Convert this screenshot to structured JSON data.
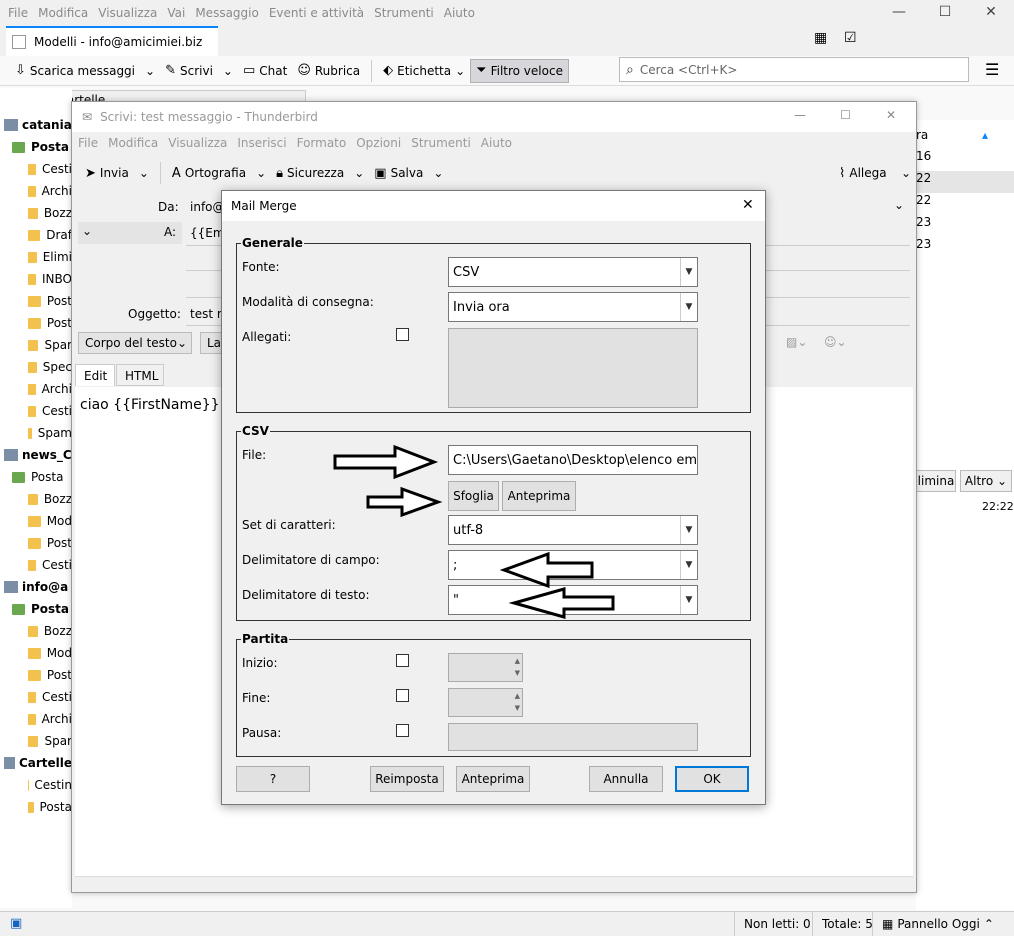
{
  "menubar": {
    "items": [
      "File",
      "Modifica",
      "Visualizza",
      "Vai",
      "Messaggio",
      "Eventi e attività",
      "Strumenti",
      "Aiuto"
    ]
  },
  "tab": {
    "label": "Modelli - info@amicimiei.biz"
  },
  "toolbar": {
    "download": "Scarica messaggi",
    "write": "Scrivi",
    "chat": "Chat",
    "addressbook": "Rubrica",
    "tag": "Etichetta",
    "quickfilter": "Filtro veloce"
  },
  "search": {
    "placeholder": "Cerca <Ctrl+K>"
  },
  "folderpane": {
    "header": "Tutte le cartelle",
    "items": [
      {
        "label": "catania",
        "type": "acct",
        "bold": true
      },
      {
        "label": "Posta",
        "type": "inbox",
        "bold": true
      },
      {
        "label": "Cesti",
        "type": "folder"
      },
      {
        "label": "Archi",
        "type": "folder"
      },
      {
        "label": "Bozz",
        "type": "folder"
      },
      {
        "label": "Draf",
        "type": "folder"
      },
      {
        "label": "Elimi",
        "type": "folder"
      },
      {
        "label": "INBO",
        "type": "folder"
      },
      {
        "label": "Post",
        "type": "folder"
      },
      {
        "label": "Post",
        "type": "folder"
      },
      {
        "label": "Spar",
        "type": "folder"
      },
      {
        "label": "Spec",
        "type": "folder"
      },
      {
        "label": "Archi",
        "type": "folder"
      },
      {
        "label": "Cesti",
        "type": "folder"
      },
      {
        "label": "Spam",
        "type": "folder"
      },
      {
        "label": "news_C",
        "type": "acct",
        "bold": true
      },
      {
        "label": "Posta",
        "type": "inbox"
      },
      {
        "label": "Bozz",
        "type": "folder"
      },
      {
        "label": "Mod",
        "type": "folder"
      },
      {
        "label": "Post",
        "type": "folder"
      },
      {
        "label": "Cesti",
        "type": "folder"
      },
      {
        "label": "info@a",
        "type": "acct",
        "bold": true
      },
      {
        "label": "Posta",
        "type": "inbox",
        "bold": true
      },
      {
        "label": "Bozz",
        "type": "folder"
      },
      {
        "label": "Mod",
        "type": "folder"
      },
      {
        "label": "Post",
        "type": "folder"
      },
      {
        "label": "Cesti",
        "type": "folder"
      },
      {
        "label": "Archi",
        "type": "folder"
      },
      {
        "label": "Spar",
        "type": "folder"
      },
      {
        "label": "Cartelle",
        "type": "acct",
        "bold": true
      },
      {
        "label": "Cestin",
        "type": "folder"
      },
      {
        "label": "Posta",
        "type": "folder"
      }
    ]
  },
  "messagelist": {
    "col": "ra",
    "rows": [
      "16",
      "22",
      "22",
      "23",
      "23"
    ],
    "delete_btn": "limina",
    "more_btn": "Altro",
    "time": "22:22"
  },
  "compose": {
    "title": "Scrivi: test messaggio - Thunderbird",
    "menu": [
      "File",
      "Modifica",
      "Visualizza",
      "Inserisci",
      "Formato",
      "Opzioni",
      "Strumenti",
      "Aiuto"
    ],
    "toolbar": {
      "send": "Invia",
      "spell": "Ortografia",
      "security": "Sicurezza",
      "save": "Salva",
      "attach": "Allega"
    },
    "from_label": "Da:",
    "from_value": "info@",
    "to_label": "A:",
    "to_value": "{{Ema",
    "subject_label": "Oggetto:",
    "subject_value": "test m",
    "format": "Corpo del testo",
    "format2": "La",
    "tab_edit": "Edit",
    "tab_html": "HTML",
    "body": "ciao {{FirstName}} {{F"
  },
  "dialog": {
    "title": "Mail Merge",
    "general": {
      "legend": "Generale",
      "source_label": "Fonte:",
      "source_value": "CSV",
      "delivery_label": "Modalità di consegna:",
      "delivery_value": "Invia ora",
      "attachments_label": "Allegati:"
    },
    "csv": {
      "legend": "CSV",
      "file_label": "File:",
      "file_value": "C:\\Users\\Gaetano\\Desktop\\elenco ema",
      "browse": "Sfoglia",
      "preview": "Anteprima",
      "charset_label": "Set di caratteri:",
      "charset_value": "utf-8",
      "field_delim_label": "Delimitatore di campo:",
      "field_delim_value": ";",
      "text_delim_label": "Delimitatore di testo:",
      "text_delim_value": "\""
    },
    "batch": {
      "legend": "Partita",
      "start_label": "Inizio:",
      "end_label": "Fine:",
      "pause_label": "Pausa:"
    },
    "buttons": {
      "help": "?",
      "reset": "Reimposta",
      "preview": "Anteprima",
      "cancel": "Annulla",
      "ok": "OK"
    }
  },
  "status": {
    "unread": "Non letti: 0",
    "total": "Totale: 5",
    "today": "Pannello Oggi"
  }
}
